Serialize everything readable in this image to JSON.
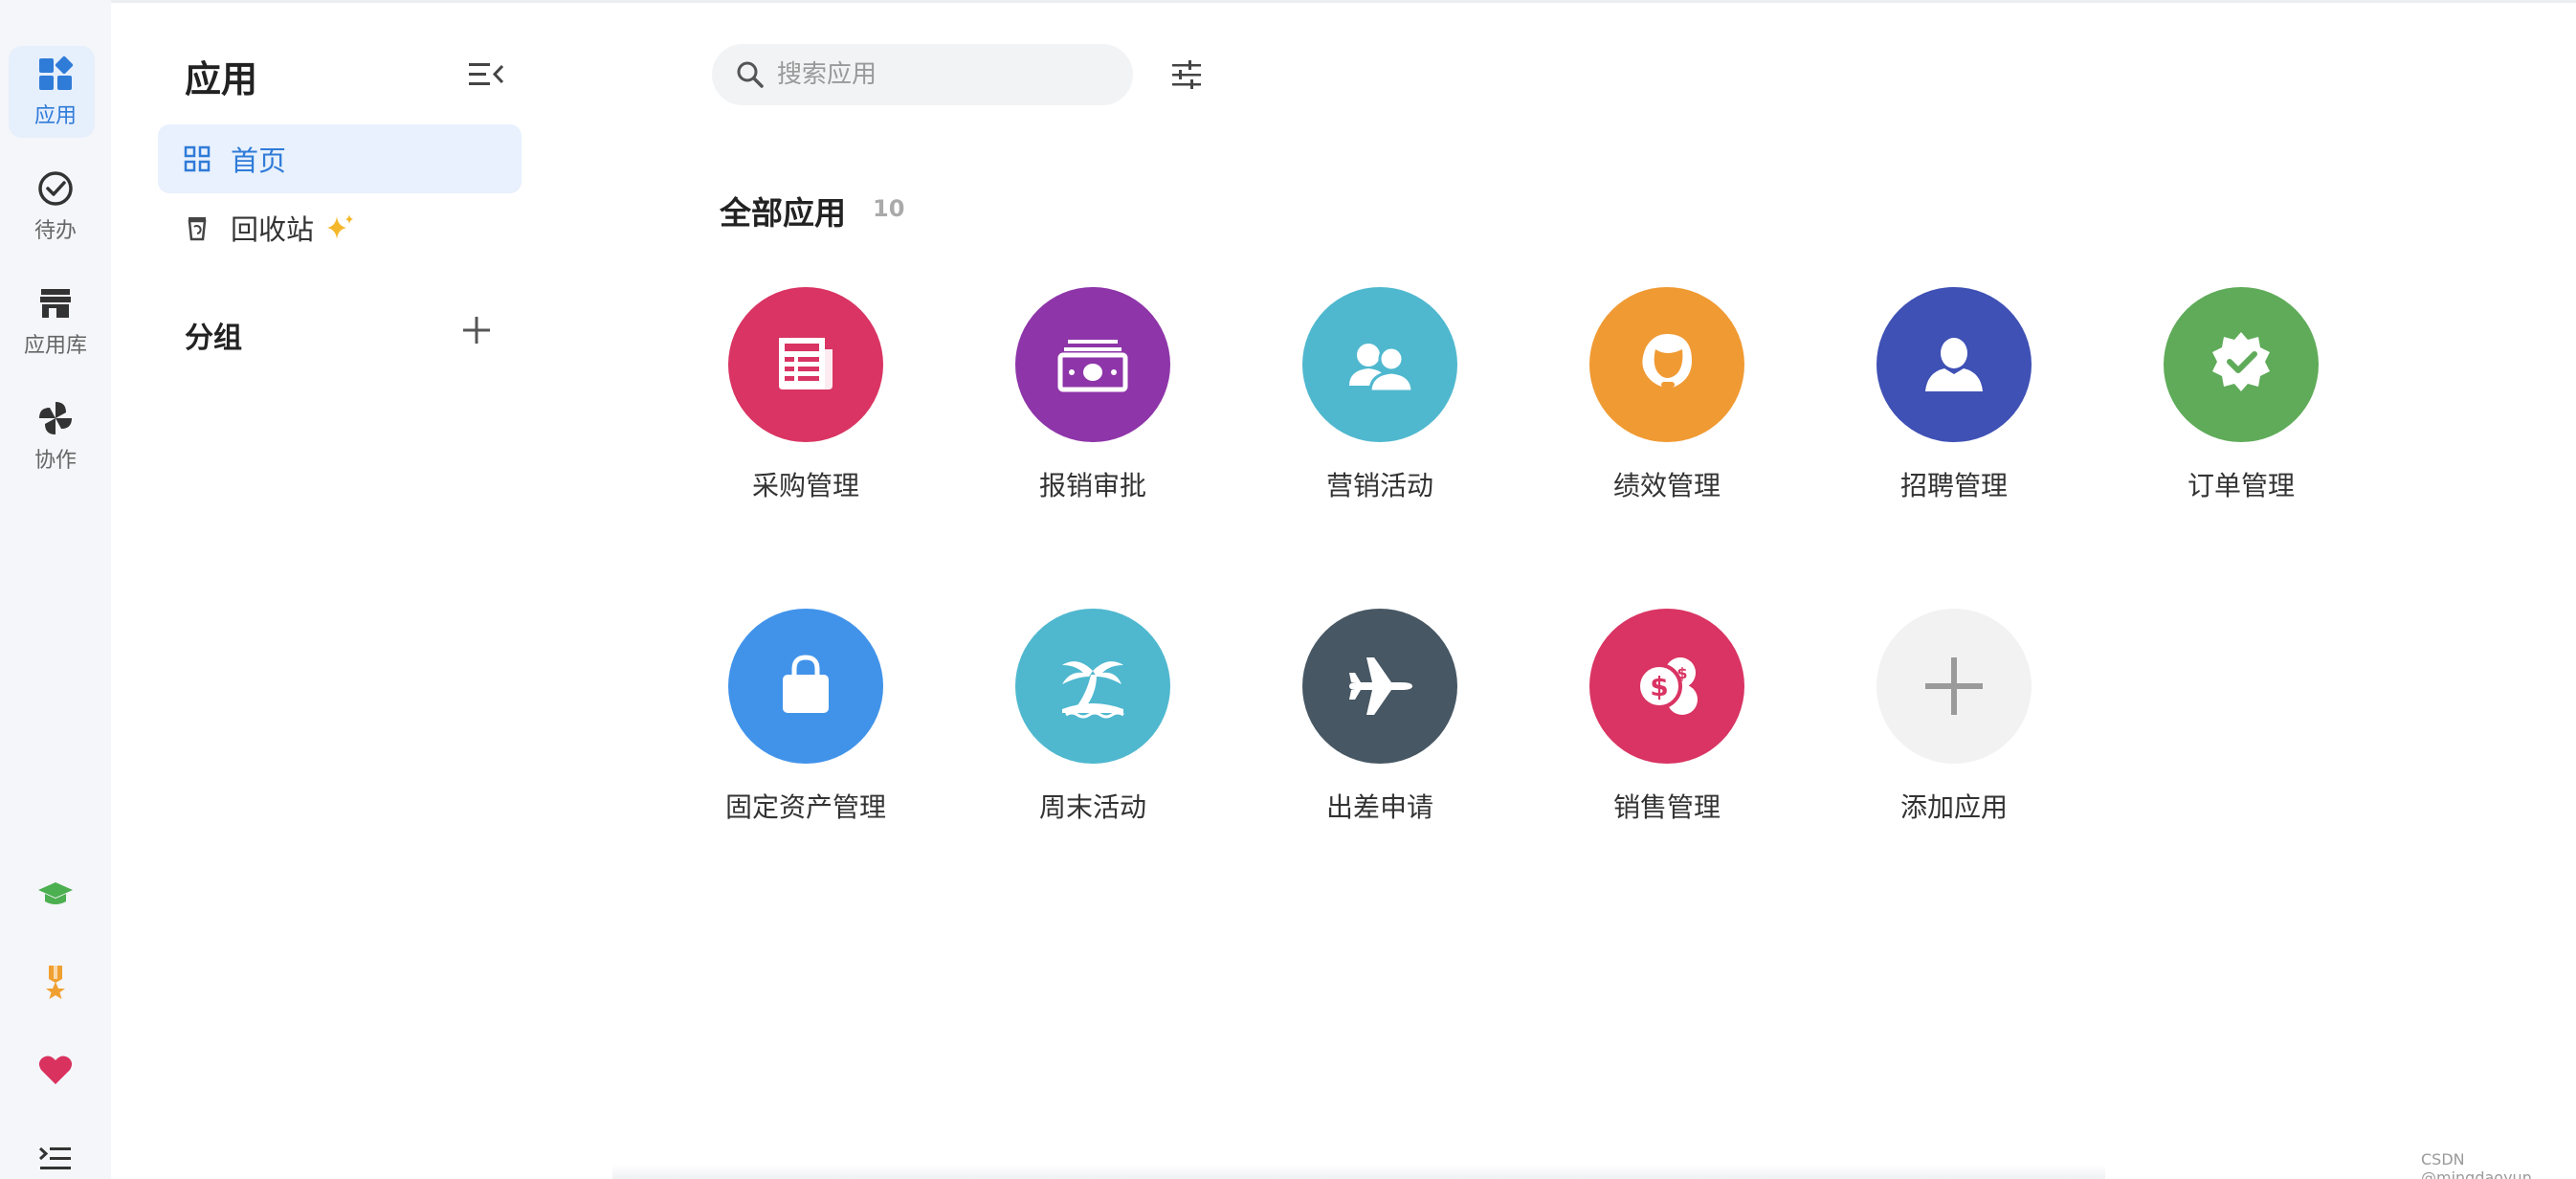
{
  "rail": {
    "items": [
      {
        "label": "应用",
        "icon": "apps-grid-icon",
        "active": true
      },
      {
        "label": "待办",
        "icon": "check-circle-icon",
        "active": false
      },
      {
        "label": "应用库",
        "icon": "store-icon",
        "active": false
      },
      {
        "label": "协作",
        "icon": "pinwheel-icon",
        "active": false
      }
    ],
    "bottom": [
      {
        "icon": "graduation-cap-icon",
        "color": "#4caf50"
      },
      {
        "icon": "medal-icon",
        "color": "#f0a030"
      },
      {
        "icon": "heart-icon",
        "color": "#d9325e"
      },
      {
        "icon": "expand-menu-icon",
        "color": "#333333"
      }
    ]
  },
  "nav": {
    "title": "应用",
    "items": [
      {
        "label": "首页",
        "icon": "grid-icon",
        "active": true
      },
      {
        "label": "回收站",
        "icon": "trash-icon",
        "active": false,
        "badge": "sparkle-icon"
      }
    ],
    "group_title": "分组"
  },
  "search": {
    "placeholder": "搜索应用",
    "value": ""
  },
  "section": {
    "title": "全部应用",
    "count": "10"
  },
  "apps": [
    {
      "label": "采购管理",
      "icon": "newspaper-icon",
      "color": "#d93463"
    },
    {
      "label": "报销审批",
      "icon": "money-stack-icon",
      "color": "#8e35a9"
    },
    {
      "label": "营销活动",
      "icon": "users-group-icon",
      "color": "#4fb8cf"
    },
    {
      "label": "绩效管理",
      "icon": "headset-agent-icon",
      "color": "#f09a33"
    },
    {
      "label": "招聘管理",
      "icon": "user-icon",
      "color": "#3f51b5"
    },
    {
      "label": "订单管理",
      "icon": "verified-badge-icon",
      "color": "#5fab59"
    },
    {
      "label": "固定资产管理",
      "icon": "bag-icon",
      "color": "#4193ea"
    },
    {
      "label": "周末活动",
      "icon": "palm-tree-icon",
      "color": "#4fb8cf"
    },
    {
      "label": "出差申请",
      "icon": "airplane-icon",
      "color": "#475763"
    },
    {
      "label": "销售管理",
      "icon": "coins-icon",
      "color": "#d93463"
    },
    {
      "label": "添加应用",
      "icon": "plus-icon",
      "color": "#f2f2f2"
    }
  ],
  "watermark": "CSDN @mingdaoyun"
}
